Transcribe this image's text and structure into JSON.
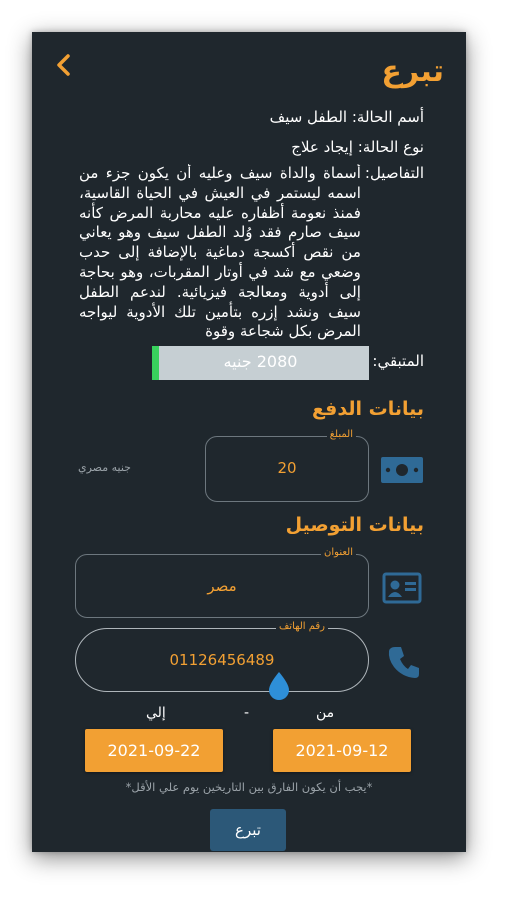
{
  "header": {
    "title": "تبرع"
  },
  "case": {
    "name_label": "أسم الحالة:",
    "name_value": "الطفل سيف",
    "type_label": "نوع الحالة:",
    "type_value": "إيجاد علاج",
    "details_label": "التفاصيل:",
    "details_text": "أسماة والداة سيف وعليه أن يكون جزء من اسمه ليستمر في العيش في الحياة القاسية، فمنذ نعومة أظفاره عليه محاربة المرض كأنه سيف صارم فقد وُلد الطفل سيف وهو يعاني من نقص أكسجة دماغية بالإضافة إلى حدب وضعي مع شد في أوتار المقربات، وهو بحاجة إلى أدوية ومعالجة فيزيائية. لندعم الطفل سيف ونشد إزره بتأمين تلك الأدوية ليواجه المرض بكل شجاعة وقوة",
    "remaining_label": "المتبقي:",
    "remaining_value": "2080 جنيه",
    "remaining_fraction": 0.03
  },
  "payment": {
    "section_title": "بيانات الدفع",
    "amount_label": "المبلغ",
    "amount_value": "20",
    "currency": "جنيه مصري"
  },
  "delivery": {
    "section_title": "بيانات التوصيل",
    "address_label": "العنوان",
    "address_value": "مصر",
    "phone_label": "رقم الهاتف",
    "phone_value": "01126456489"
  },
  "dates": {
    "from_label": "من",
    "separator": "-",
    "to_label": "إلي",
    "from_date": "2021-09-12",
    "to_date": "2021-09-22",
    "note": "*يجب أن يكون الفارق بين التاريخين يوم علي الأقل*"
  },
  "submit_label": "تبرع",
  "colors": {
    "accent": "#f2a033",
    "background": "#1f272d",
    "icon": "#2f6a96",
    "progress": "#38d25d"
  }
}
